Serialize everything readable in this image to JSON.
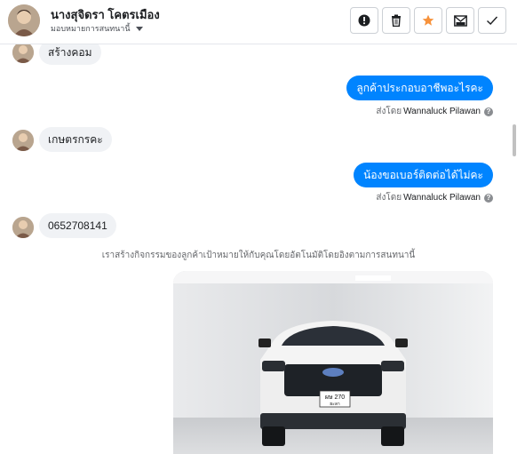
{
  "header": {
    "name": "นางสุจิดรา โคตรเมือง",
    "assign_label": "มอบหมายการสนทนานี้"
  },
  "actions": [
    {
      "name": "mark-spam-button",
      "icon": "exclamation-icon"
    },
    {
      "name": "delete-button",
      "icon": "trash-icon"
    },
    {
      "name": "star-button",
      "icon": "star-icon"
    },
    {
      "name": "mark-unread-button",
      "icon": "envelope-icon"
    },
    {
      "name": "mark-done-button",
      "icon": "check-icon"
    }
  ],
  "messages": {
    "m1": "สร้างคอม",
    "m2": "ลูกค้าประกอบอาชีพอะไรคะ",
    "m2_sent_prefix": "ส่งโดย",
    "m2_sender": "Wannaluck Pilawan",
    "m3": "เกษตรกรคะ",
    "m4": "น้องขอเบอร์ติดต่อได้ไม่คะ",
    "m4_sent_prefix": "ส่งโดย",
    "m4_sender": "Wannaluck Pilawan",
    "m5": "0652708141",
    "notice": "เราสร้างกิจกรรมของลูกค้าเป้าหมายให้กับคุณโดยอัตโนมัติโดยอิงตามการสนทนานี้",
    "plate_line1": "ผษ 270",
    "plate_line2": "ยะลา"
  },
  "colors": {
    "accent_blue": "#0084ff",
    "star_orange": "#f7923b"
  }
}
